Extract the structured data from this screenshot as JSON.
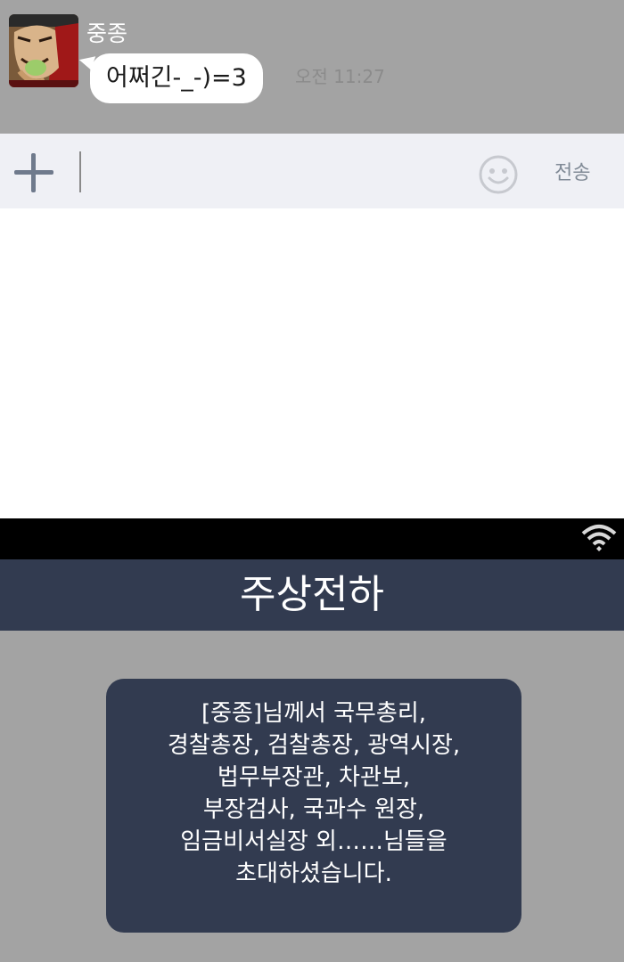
{
  "chat": {
    "sender_name": "중종",
    "message": "어쩌긴-_-)=3",
    "time": "오전 11:27"
  },
  "input_bar": {
    "send_label": "전송",
    "plus_icon": "plus-icon",
    "emoji_icon": "smiley-icon"
  },
  "chat_room": {
    "title": "주상전하",
    "status_icon": "wifi-icon",
    "notice_lines": [
      "[중종]님께서 국무총리,",
      "경찰총장, 검찰총장, 광역시장,",
      "법무부장관, 차관보,",
      "부장검사, 국과수 원장,",
      "임금비서실장 외……님들을",
      "초대하셨습니다."
    ]
  },
  "colors": {
    "chat_background": "#a3a3a3",
    "input_bar_background": "#eff0f5",
    "title_bar": "#323b50",
    "notice_box": "#323b50",
    "status_bar": "#000000"
  }
}
